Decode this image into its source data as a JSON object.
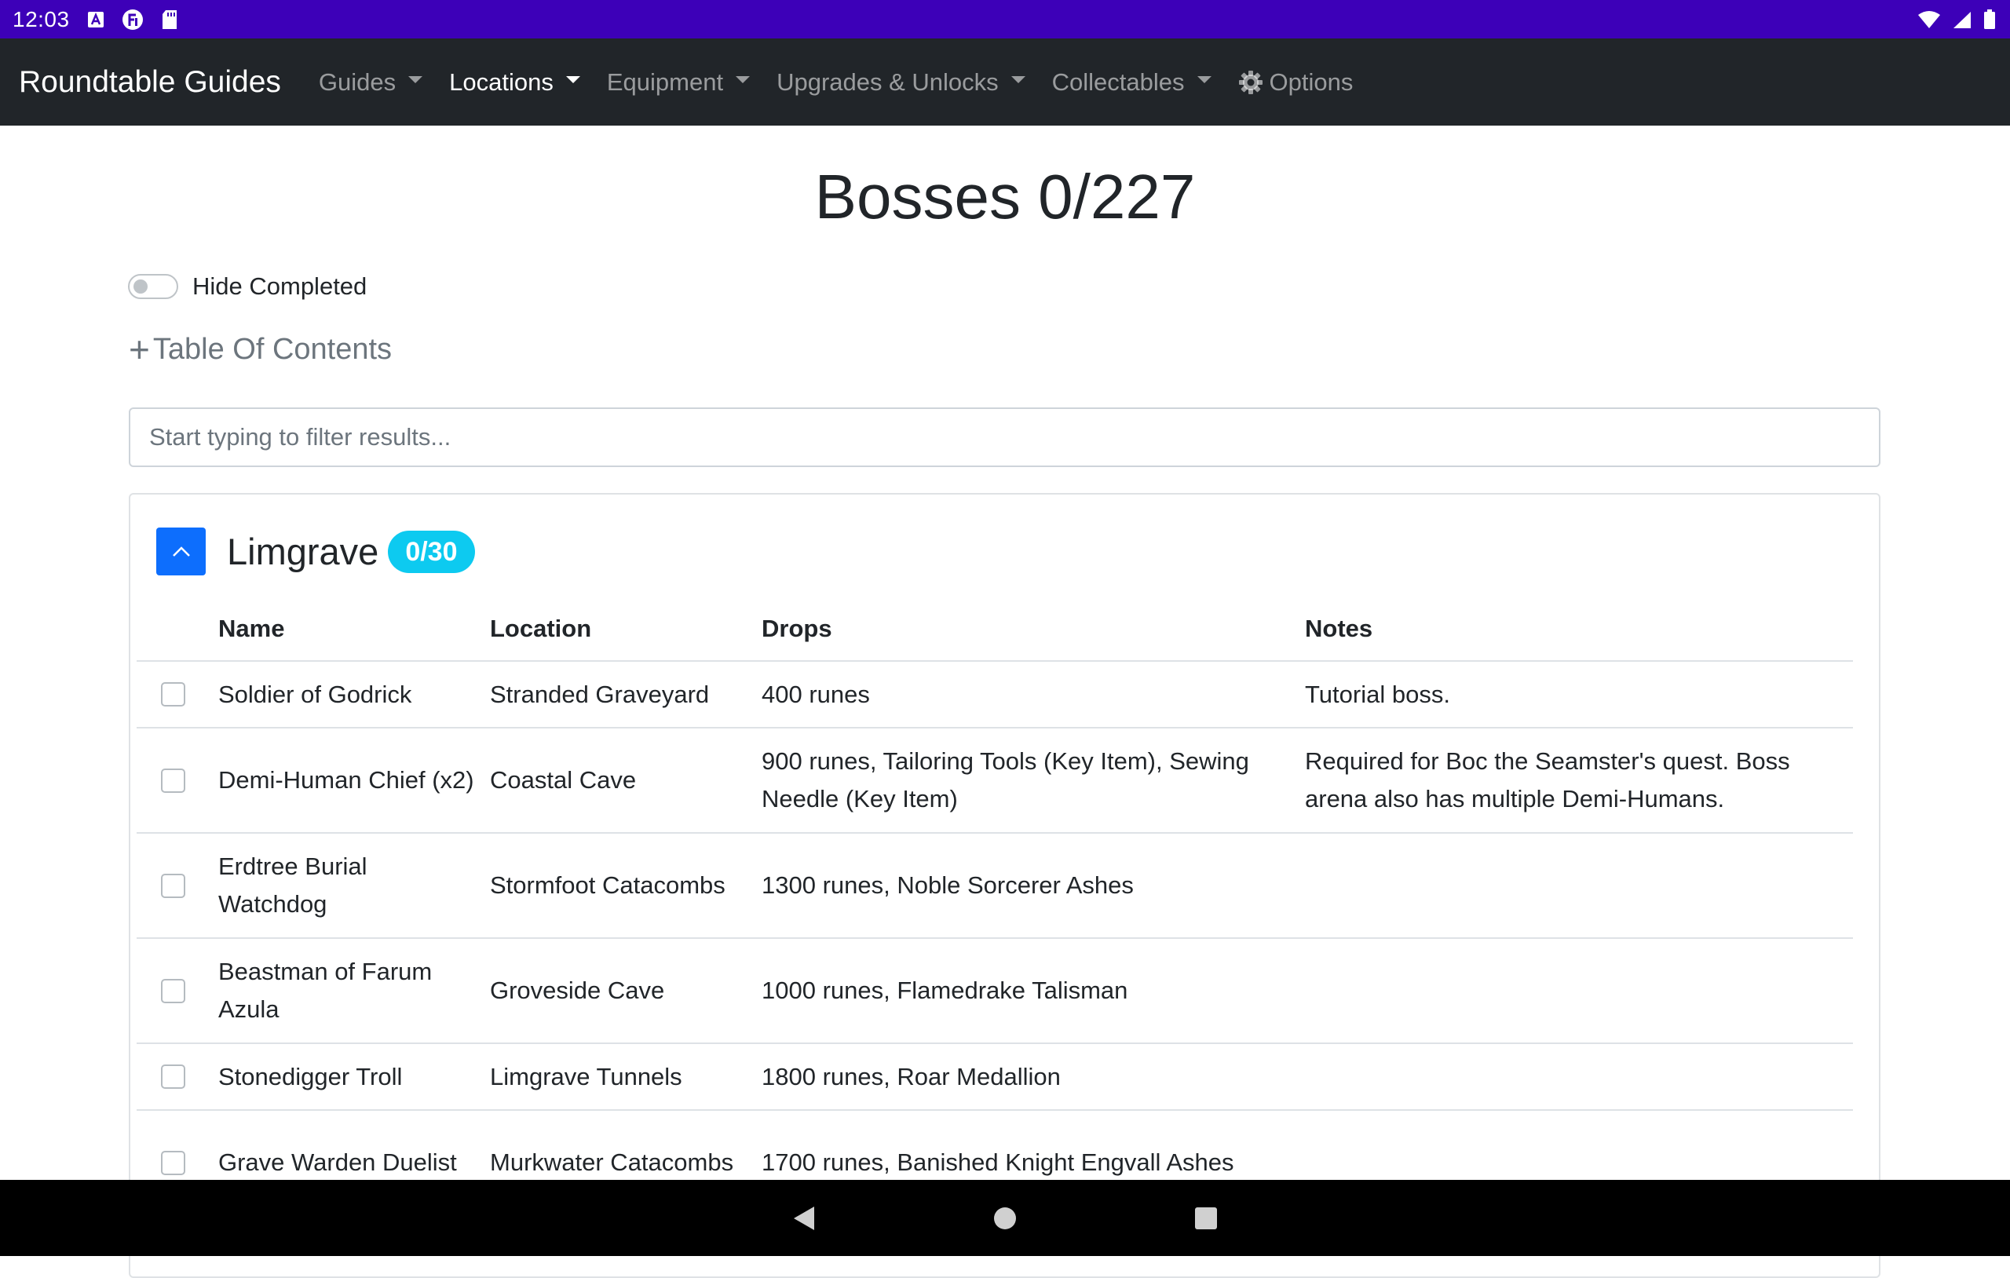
{
  "status_bar": {
    "time": "12:03",
    "left_icons": [
      "a-notification-icon",
      "f-notification-icon",
      "sd-card-icon"
    ],
    "right_icons": [
      "wifi-icon",
      "signal-icon",
      "battery-icon"
    ]
  },
  "navbar": {
    "brand": "Roundtable Guides",
    "items": [
      {
        "label": "Guides",
        "active": false,
        "dropdown": true
      },
      {
        "label": "Locations",
        "active": true,
        "dropdown": true
      },
      {
        "label": "Equipment",
        "active": false,
        "dropdown": true
      },
      {
        "label": "Upgrades & Unlocks",
        "active": false,
        "dropdown": true
      },
      {
        "label": "Collectables",
        "active": false,
        "dropdown": true
      }
    ],
    "options_label": "Options",
    "options_icon": "gear-icon"
  },
  "page": {
    "title": "Bosses 0/227",
    "hide_completed_label": "Hide Completed",
    "toc_label": "Table Of Contents",
    "filter_placeholder": "Start typing to filter results..."
  },
  "section": {
    "name": "Limgrave",
    "badge": "0/30",
    "columns": {
      "name": "Name",
      "location": "Location",
      "drops": "Drops",
      "notes": "Notes"
    },
    "rows": [
      {
        "name": "Soldier of Godrick",
        "location": "Stranded Graveyard",
        "drops": "400 runes",
        "notes": "Tutorial boss."
      },
      {
        "name": "Demi-Human Chief (x2)",
        "location": "Coastal Cave",
        "drops": "900 runes, Tailoring Tools (Key Item), Sewing Needle (Key Item)",
        "notes": "Required for Boc the Seamster's quest. Boss arena also has multiple Demi-Humans."
      },
      {
        "name": "Erdtree Burial Watchdog",
        "location": "Stormfoot Catacombs",
        "drops": "1300 runes, Noble Sorcerer Ashes",
        "notes": ""
      },
      {
        "name": "Beastman of Farum Azula",
        "location": "Groveside Cave",
        "drops": "1000 runes, Flamedrake Talisman",
        "notes": ""
      },
      {
        "name": "Stonedigger Troll",
        "location": "Limgrave Tunnels",
        "drops": "1800 runes, Roar Medallion",
        "notes": ""
      },
      {
        "name": "Grave Warden Duelist",
        "location": "Murkwater Catacombs",
        "drops": "1700 runes, Banished Knight Engvall Ashes",
        "notes": ""
      }
    ]
  },
  "colors": {
    "status_bar": "#3d00b8",
    "navbar": "#212529",
    "primary": "#0d6efd",
    "badge": "#0dcaf0"
  }
}
